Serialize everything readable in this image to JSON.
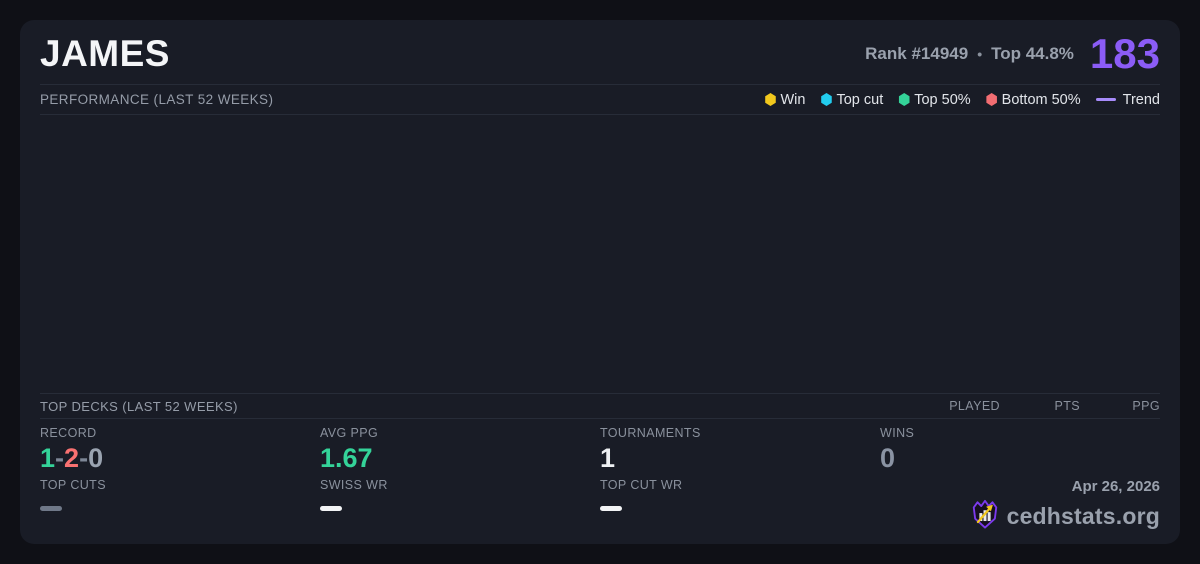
{
  "header": {
    "player_name": "JAMES",
    "rank": "Rank #14949",
    "separator": "•",
    "top_percent": "Top 44.8%",
    "score": "183",
    "score_color": "#8b5cf6"
  },
  "performance": {
    "title": "PERFORMANCE (LAST 52 WEEKS)",
    "legend": {
      "win": {
        "label": "Win",
        "color": "#f2c81d"
      },
      "top_cut": {
        "label": "Top cut",
        "color": "#22ccee"
      },
      "top_50": {
        "label": "Top 50%",
        "color": "#34d399"
      },
      "bottom_50": {
        "label": "Bottom 50%",
        "color": "#f26d72"
      },
      "trend": {
        "label": "Trend",
        "color": "#a78bfa"
      }
    },
    "chart_points": []
  },
  "top_decks": {
    "title": "TOP DECKS (LAST 52 WEEKS)",
    "columns": {
      "played": "PLAYED",
      "pts": "PTS",
      "ppg": "PPG"
    },
    "rows": []
  },
  "stats": {
    "record": {
      "label": "RECORD",
      "wins": "1",
      "losses": "2",
      "draws": "0",
      "separator": "-",
      "win_color": "#34d399",
      "loss_color": "#f87171",
      "draw_color": "#9aa3b0"
    },
    "avg_ppg": {
      "label": "AVG PPG",
      "value": "1.67",
      "color": "#34d399"
    },
    "tournaments": {
      "label": "TOURNAMENTS",
      "value": "1"
    },
    "wins": {
      "label": "WINS",
      "value": "0"
    },
    "top_cuts": {
      "label": "TOP CUTS",
      "value": "—"
    },
    "swiss_wr": {
      "label": "SWISS WR",
      "value": "—"
    },
    "top_cut_wr": {
      "label": "TOP CUT WR",
      "value": "—"
    }
  },
  "footer": {
    "date": "Apr 26, 2026",
    "brand": "cedhstats.org"
  }
}
